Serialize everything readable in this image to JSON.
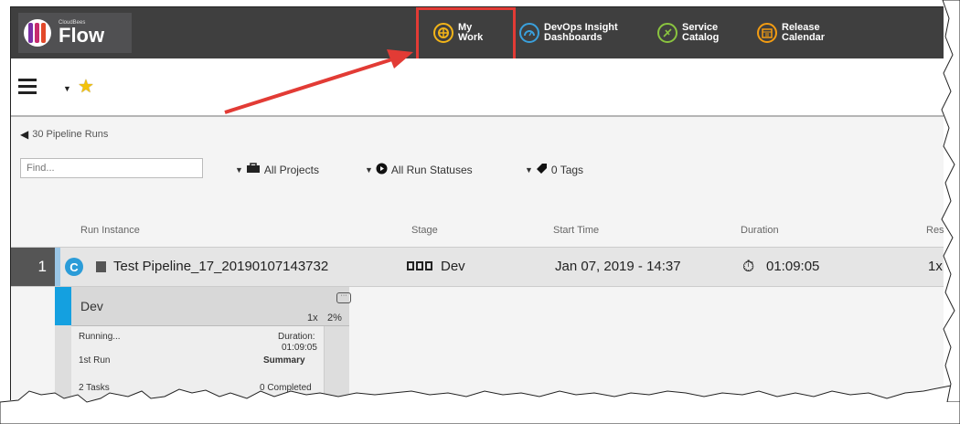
{
  "brand": {
    "small": "CloudBees",
    "name": "Flow"
  },
  "nav": [
    {
      "label": "My\nWork",
      "icon": "my-work-icon",
      "color": "#f2b418"
    },
    {
      "label": "DevOps Insight\nDashboards",
      "icon": "dashboard-icon",
      "color": "#3aa0dc"
    },
    {
      "label": "Service\nCatalog",
      "icon": "service-catalog-icon",
      "color": "#8ac43f"
    },
    {
      "label": "Release\nCalendar",
      "icon": "release-calendar-icon",
      "color": "#f39c12"
    }
  ],
  "back_label": "30 Pipeline Runs",
  "find_placeholder": "Find...",
  "filters": {
    "projects": "All Projects",
    "statuses": "All Run Statuses",
    "tags": "0 Tags"
  },
  "columns": {
    "run_instance": "Run Instance",
    "stage": "Stage",
    "start_time": "Start Time",
    "duration": "Duration",
    "result": "Res"
  },
  "row": {
    "number": "1",
    "run_icon": "C",
    "name": "Test Pipeline_17_20190107143732",
    "stage": "Dev",
    "start_time": "Jan 07, 2019 - 14:37",
    "duration": "01:09:05",
    "result": "1x"
  },
  "card": {
    "title": "Dev",
    "count": "1x",
    "percent": "2%",
    "status": "Running...",
    "duration_label": "Duration:",
    "duration": "01:09:05",
    "run": "1st Run",
    "summary": "Summary",
    "footer_left": "2 Tasks",
    "footer_right": "0 Completed"
  }
}
